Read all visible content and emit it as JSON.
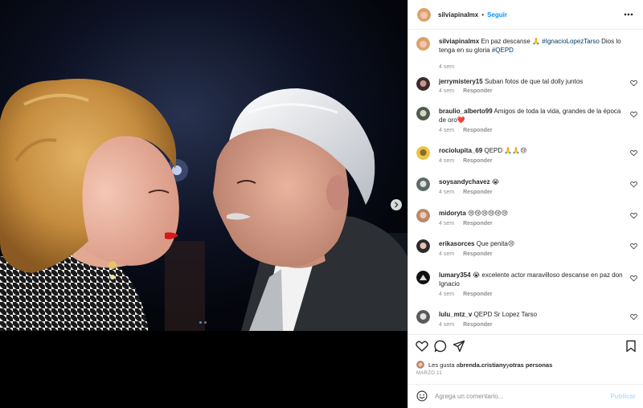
{
  "post": {
    "username": "silviapinalmx",
    "follow_label": "Seguir",
    "separator": "•",
    "caption": {
      "username": "silviapinalmx",
      "text_before": "En paz descanse 🙏 ",
      "hashtag1": "#IgnacioLopezTarso",
      "text_middle": " Dios lo tenga en su gloria ",
      "hashtag2": "#QEPD",
      "time": "4 sem"
    }
  },
  "comments": [
    {
      "username": "jerrymistery15",
      "text": "Suban fotos de que tal dolly juntos",
      "time": "4 sem",
      "reply": "Responder"
    },
    {
      "username": "braulio_alberto99",
      "text": "Amigos de toda la vida, grandes de la época de oro❤️",
      "time": "4 sem",
      "reply": "Responder"
    },
    {
      "username": "rociolupita_69",
      "text": "QEPD 🙏🙏😢",
      "time": "4 sem",
      "reply": "Responder"
    },
    {
      "username": "soysandychavez",
      "text": "😭",
      "time": "4 sem",
      "reply": "Responder"
    },
    {
      "username": "midoryta",
      "text": "😢😢😢😢😢😢",
      "time": "4 sem",
      "reply": "Responder"
    },
    {
      "username": "erikasorces",
      "text": "Que penita😢",
      "time": "4 sem",
      "reply": "Responder"
    },
    {
      "username": "lumary354",
      "text": "😭 excelente actor maravilloso descanse en paz don Ignacio",
      "time": "4 sem",
      "reply": "Responder"
    },
    {
      "username": "lulu_mtz_v",
      "text": "QEPD Sr Lopez Tarso",
      "time": "4 sem",
      "reply": "Responder"
    }
  ],
  "likes": {
    "prefix": "Les gusta a ",
    "user": "brenda.cristiany",
    "middle": " y ",
    "others": "otras personas"
  },
  "date": "MARZO 11",
  "add_comment": {
    "placeholder": "Agrega un comentario...",
    "post_label": "Publicar"
  },
  "icons": {
    "more": "more-options-icon",
    "like": "heart-icon",
    "comment": "comment-icon",
    "share": "share-icon",
    "save": "bookmark-icon",
    "emoji": "smile-icon",
    "next": "chevron-right-icon"
  },
  "colors": {
    "link": "#0095f6",
    "hashtag": "#00376b",
    "muted": "#8e8e8e",
    "post_disabled": "#b2dffc"
  }
}
